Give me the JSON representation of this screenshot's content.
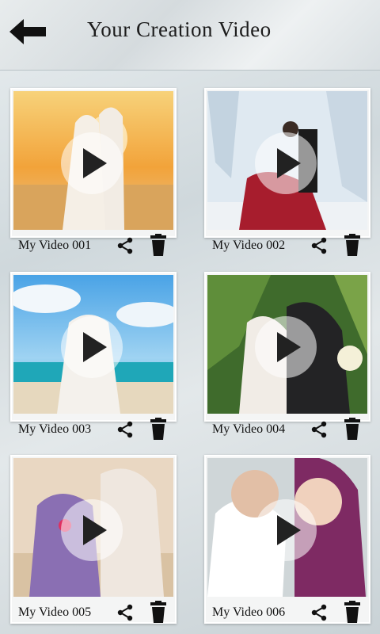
{
  "header": {
    "title": "Your Creation Video",
    "back_icon": "arrow-left-icon"
  },
  "videos": [
    {
      "label": "My Video 001",
      "scene": "sunset beach couple"
    },
    {
      "label": "My Video 002",
      "scene": "ice cave couple, red dress"
    },
    {
      "label": "My Video 003",
      "scene": "tropical beach couple"
    },
    {
      "label": "My Video 004",
      "scene": "garden couple embrace"
    },
    {
      "label": "My Video 005",
      "scene": "couple with rose"
    },
    {
      "label": "My Video 006",
      "scene": "smiling couple close-up"
    }
  ],
  "icons": {
    "play": "play-icon",
    "share": "share-icon",
    "delete": "trash-icon"
  }
}
